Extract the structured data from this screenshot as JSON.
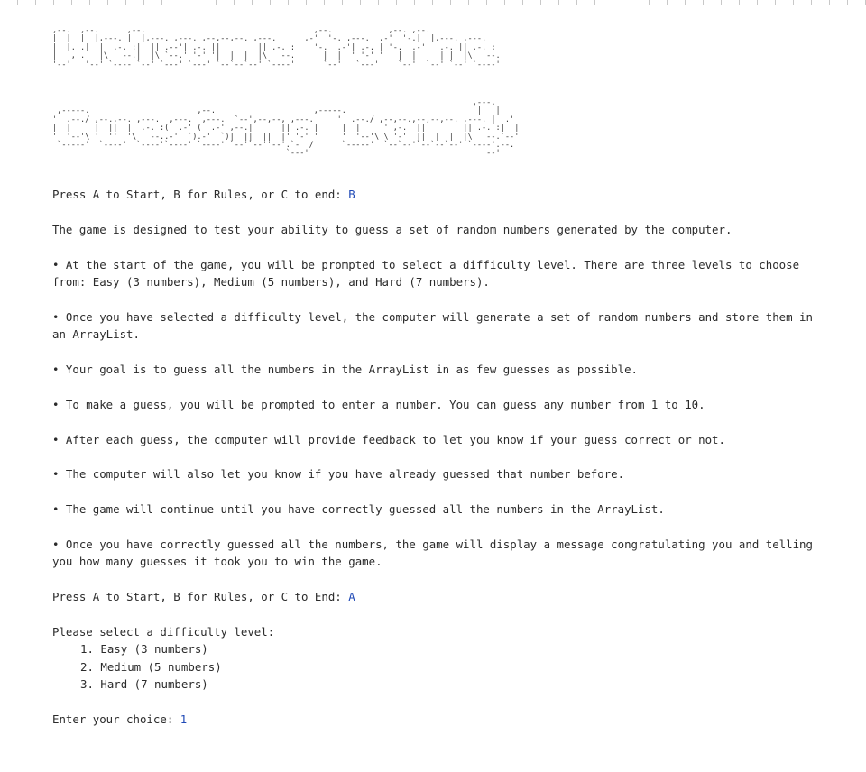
{
  "banner": {
    "line1_art": ",--.  ,--.      ,--.                                    ,--.            ,--. ,--.\n|  |  |  |,---. |  |,---. ,---. ,--,--,--. ,---.      ,-'  '-. ,---.  ,-'  '-.|  |,---. ,---.\n|  |.'.|  || .-. :|  || .--'| .-. ||        || .-. :    '-.  .-'| .-. | '-.  .-'|  .-. || .-. :\n|   ,'.   |\\   --.|  |\\ `--.' '-' '|  |  |  |\\   --.      |  |  ' '-' '   |  |  |  | |  |\\   --.\n'--'   '--' `----'`--' `---' `---' `--`--`--' `----'      `--'   `---'    `--'  `--' `--' `----'",
    "line2_art": "                                                                                          ,---.\n ,-----.                       ,--.                     ,-----.                            |   |\n'  .--./ ,--.,--. ,---.  ,---.  ,---.  `--',--,--, ,---.     '  .--./ ,--,--.,--,--,--. ,---. |  .'\n|  |     |  ||  || .-. :(  .-' (  .-' ,--.|      || .-. |     |  |     ' ,-.  ||        || .-. :|  |\n'  '--'\\ '  ''  '\\   --..-'  `).-'  `)|  ||  ||  |' '-' '     '  '--'\\ \\ '-'  ||  |  |  |\\   --.`--'\n `-----'  `----'  `----'`----' `----' `--'`--''--'.`-  /      `-----'  `--`--'`--`--`--' `----'.--.\n                                                  `---'                                     '--'"
  },
  "console": {
    "menu_prompt_1": "Press A to Start, B for Rules, or C to end: ",
    "menu_input_1": "B",
    "intro": "The game is designed to test your ability to guess a set of random numbers generated by the computer.",
    "rules": [
      "• At the start of the game, you will be prompted to select a difficulty level. There are three levels to choose from: Easy (3 numbers), Medium (5 numbers), and Hard (7 numbers).",
      "• Once you have selected a difficulty level, the computer will generate a set of random numbers and store them in an ArrayList.",
      "• Your goal is to guess all the numbers in the ArrayList in as few guesses as possible.",
      "• To make a guess, you will be prompted to enter a number. You can guess any number from 1 to 10.",
      "• After each guess, the computer will provide feedback to let you know if your guess correct or not.",
      "• The computer will also let you know if you have already guessed that number before.",
      "• The game will continue until you have correctly guessed all the numbers in the ArrayList.",
      "• Once you have correctly guessed all the numbers, the game will display a message congratulating you and telling you how many guesses it took you to win the game."
    ],
    "menu_prompt_2": "Press A to Start, B for Rules, or C to End: ",
    "menu_input_2": "A",
    "difficulty_prompt": "Please select a difficulty level:",
    "difficulty_options": [
      "1. Easy (3 numbers)",
      "2. Medium (5 numbers)",
      "3. Hard (7 numbers)"
    ],
    "choice_prompt": "Enter your choice: ",
    "choice_input": "1"
  },
  "colors": {
    "input_text": "#1f49b6",
    "output_text": "#2b2b2b"
  }
}
